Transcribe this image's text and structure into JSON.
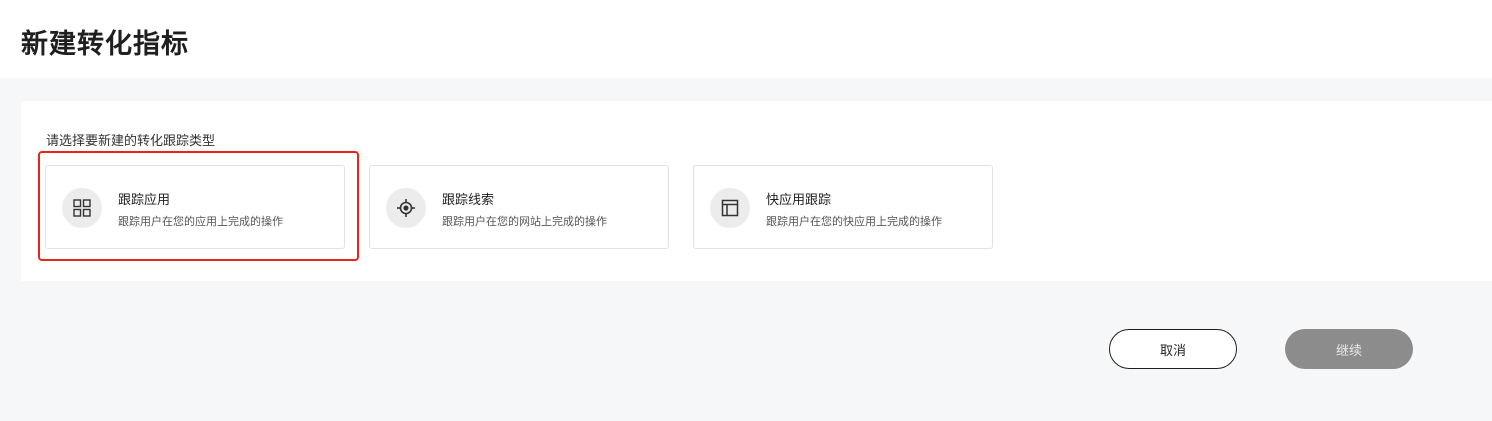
{
  "page": {
    "title": "新建转化指标"
  },
  "panel": {
    "prompt": "请选择要新建的转化跟踪类型"
  },
  "cards": [
    {
      "title": "跟踪应用",
      "desc": "跟踪用户在您的应用上完成的操作",
      "icon": "grid-icon",
      "selected": true
    },
    {
      "title": "跟踪线索",
      "desc": "跟踪用户在您的网站上完成的操作",
      "icon": "target-icon",
      "selected": false
    },
    {
      "title": "快应用跟踪",
      "desc": "跟踪用户在您的快应用上完成的操作",
      "icon": "layout-icon",
      "selected": false
    }
  ],
  "actions": {
    "cancel_label": "取消",
    "continue_label": "继续"
  },
  "colors": {
    "selected_border": "#e5261a",
    "continue_disabled": "#8c8c8c"
  }
}
